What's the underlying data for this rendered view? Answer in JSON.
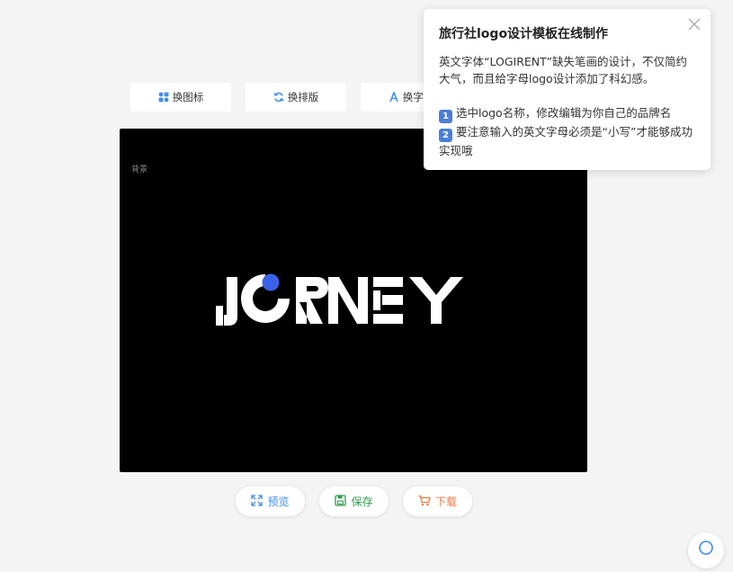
{
  "toolbar": {
    "buttons": [
      {
        "label": "换图标",
        "icon": "grid-icon"
      },
      {
        "label": "换排版",
        "icon": "refresh-icon"
      },
      {
        "label": "换字体",
        "icon": "font-icon"
      }
    ]
  },
  "canvas": {
    "background_label": "背景",
    "background_color": "#000000",
    "logo_text": "JORNEY",
    "accent_dot_color": "#3a62e8"
  },
  "actions": {
    "preview": {
      "label": "预览",
      "icon": "expand-icon",
      "color": "#3f8ef2"
    },
    "save": {
      "label": "保存",
      "icon": "save-icon",
      "color": "#2f9a4b"
    },
    "download": {
      "label": "下载",
      "icon": "cart-icon",
      "color": "#f07b3f"
    }
  },
  "tip": {
    "title": "旅行社logo设计模板在线制作",
    "intro": "英文字体“LOGIRENT”缺失笔画的设计，不仅简约大气，而且给字母logo设计添加了科幻感。",
    "step1_num": "1",
    "step1": "选中logo名称，修改编辑为你自己的品牌名",
    "step2_num": "2",
    "step2": "要注意输入的英文字母必须是“小写”才能够成功实现哦"
  }
}
